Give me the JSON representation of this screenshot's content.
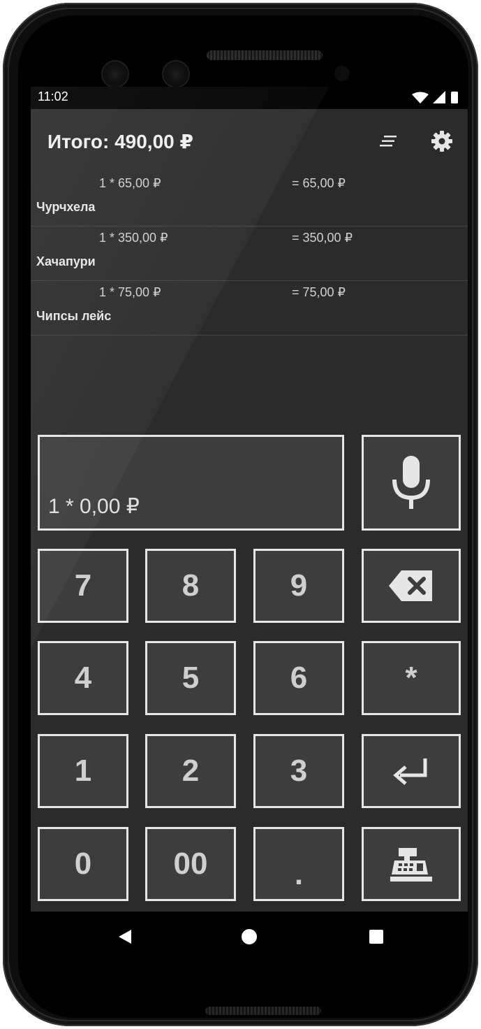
{
  "status_bar": {
    "time": "11:02",
    "icons": [
      "wifi-icon",
      "signal-icon",
      "battery-icon"
    ]
  },
  "header": {
    "title": "Итого: 490,00 ₽",
    "actions": [
      "sort-icon",
      "gear-icon"
    ]
  },
  "items": [
    {
      "calc": "1 * 65,00 ₽",
      "sum": "= 65,00 ₽",
      "name": "Чурчхела"
    },
    {
      "calc": "1 * 350,00 ₽",
      "sum": "= 350,00 ₽",
      "name": "Хачапури"
    },
    {
      "calc": "1 * 75,00 ₽",
      "sum": "= 75,00 ₽",
      "name": "Чипсы лейс"
    }
  ],
  "input": {
    "value": "1 * 0,00 ₽"
  },
  "keypad": {
    "k7": "7",
    "k8": "8",
    "k9": "9",
    "k4": "4",
    "k5": "5",
    "k6": "6",
    "multiply": "*",
    "k1": "1",
    "k2": "2",
    "k3": "3",
    "k0": "0",
    "k00": "00",
    "dot": ".",
    "icons": [
      "microphone-icon",
      "backspace-icon",
      "enter-icon",
      "cash-register-icon"
    ]
  },
  "nav_bar": {
    "icons": [
      "back-icon",
      "home-icon",
      "recents-icon"
    ]
  },
  "colors": {
    "background": "#2b2b2b",
    "key_fill": "#3d3d3d",
    "key_border": "#e6e6e6",
    "text": "#e0e0e0"
  }
}
